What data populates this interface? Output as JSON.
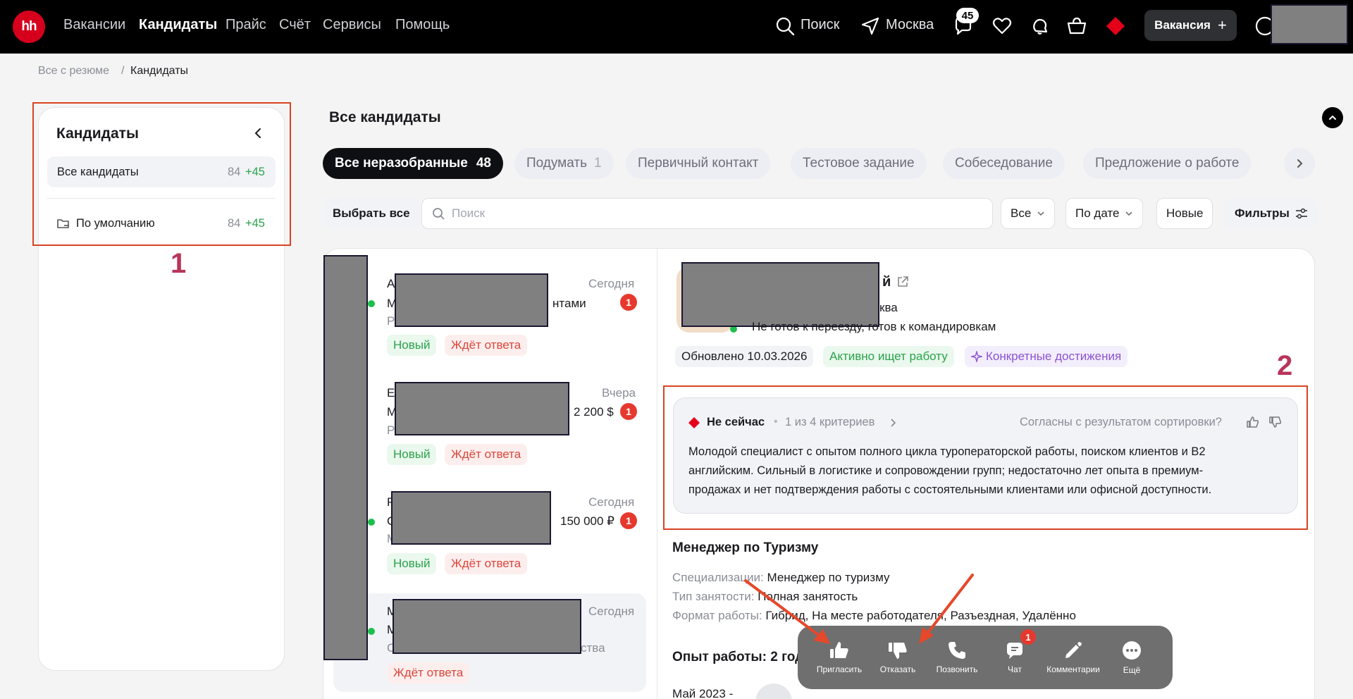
{
  "header": {
    "logo": "hh",
    "nav": [
      "Вакансии",
      "Кандидаты",
      "Прайс",
      "Счёт",
      "Сервисы",
      "Помощь"
    ],
    "active_nav": "Кандидаты",
    "search": "Поиск",
    "city": "Москва",
    "messages_count": "45",
    "vacancy_button": "Вакансия"
  },
  "breadcrumb": {
    "root": "Все с резюме",
    "separator": "/",
    "current": "Кандидаты"
  },
  "sidebar": {
    "title": "Кандидаты",
    "items": [
      {
        "label": "Все кандидаты",
        "count": "84",
        "new": "+45"
      },
      {
        "label": "По умолчанию",
        "count": "84",
        "new": "+45"
      }
    ]
  },
  "annotations": {
    "label1": "1",
    "label2": "2"
  },
  "main": {
    "title": "Все кандидаты",
    "chips": [
      {
        "label": "Все неразобранные",
        "count": "48"
      },
      {
        "label": "Подумать",
        "count": "1"
      },
      {
        "label": "Первичный контакт",
        "count": ""
      },
      {
        "label": "Тестовое задание",
        "count": ""
      },
      {
        "label": "Собеседование",
        "count": ""
      },
      {
        "label": "Предложение о работе",
        "count": ""
      }
    ],
    "toolbar": {
      "select_all": "Выбрать все",
      "search_placeholder": "Поиск",
      "filter_all": "Все",
      "sort": "По дате",
      "newest": "Новые",
      "filters": "Фильтры"
    }
  },
  "candidates": [
    {
      "initial": "А",
      "line2_prefix": "М",
      "line2_suffix": "нтами",
      "line3": "Р",
      "date": "Сегодня",
      "unread": "1",
      "salary": "",
      "tags": [
        "Новый",
        "Ждёт ответа"
      ]
    },
    {
      "initial": "Е",
      "line2_prefix": "М",
      "line2_suffix": "",
      "line3": "Р",
      "date": "Вчера",
      "unread": "1",
      "salary": "2 200 $",
      "tags": [
        "Новый",
        "Ждёт ответа"
      ]
    },
    {
      "initial": "Р",
      "line2_prefix": "С",
      "line2_suffix": "",
      "line3": "М",
      "date": "Сегодня",
      "unread": "1",
      "salary": "150 000 ₽",
      "tags": [
        "Новый",
        "Ждёт ответа"
      ]
    },
    {
      "initial": "М",
      "line2_prefix": "М",
      "line2_suffix": "",
      "line3": "С",
      "line3_suffix": "ства",
      "date": "Сегодня",
      "unread": "",
      "salary": "",
      "tags": [
        "Ждёт ответа"
      ]
    }
  ],
  "detail": {
    "name_suffix": "й",
    "location_suffix": "ква",
    "relocation": "Не готов к переезду, готов к командировкам",
    "updated": "Обновлено 10.03.2026",
    "status_pill": "Активно ищет работу",
    "achievements_pill": "Конкретные достижения",
    "ai": {
      "verdict": "Не сейчас",
      "criteria": "1 из 4 критериев",
      "feedback_question": "Согласны с результатом сортировки?",
      "summary": [
        "Молодой специалист с опытом полного цикла туроператорской работы, поиском клиентов и B2",
        "английским. Сильный в логистике и сопровождении групп; недостаточно лет опыта в премиум-",
        "продажах и нет подтверждения работы с состоятельными клиентами или офисной доступности."
      ]
    },
    "position": "Менеджер по Туризму",
    "spec_label": "Специализации:",
    "spec_value": "Менеджер по туризму",
    "employment_label": "Тип занятости:",
    "employment_value": "Полная занятость",
    "format_label": "Формат работы:",
    "format_value": "Гибрид, На месте работодателя, Разъездная, Удалённо",
    "experience": "Опыт работы: 2 год",
    "period": "Май 2023 -"
  },
  "actions": [
    {
      "label": "Пригласить",
      "icon": "thumb-up-icon"
    },
    {
      "label": "Отказать",
      "icon": "thumb-down-icon"
    },
    {
      "label": "Позвонить",
      "icon": "phone-icon"
    },
    {
      "label": "Чат",
      "icon": "chat-icon",
      "badge": "1"
    },
    {
      "label": "Комментарии",
      "icon": "pencil-icon"
    },
    {
      "label": "Ещё",
      "icon": "more-icon"
    }
  ],
  "colors": {
    "accent": "#d6001c",
    "annotation": "#d94323",
    "annotation_text": "#b8355a",
    "success": "#2aa34a",
    "danger": "#d9473a"
  }
}
